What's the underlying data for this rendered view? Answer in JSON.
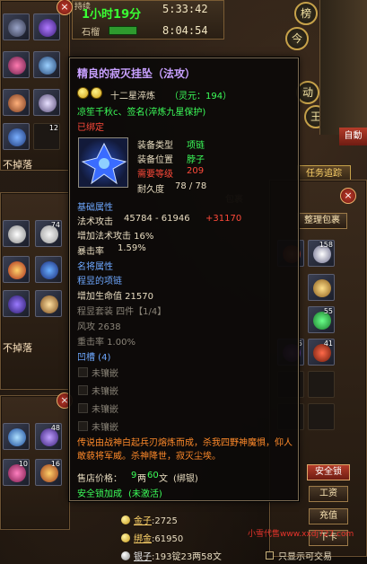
{
  "header": {
    "timer_green": "1小时19分",
    "top_small_left": "持续",
    "time_1": "5:33:42",
    "timer_label_2": "石榴",
    "time_2": "8:04:54"
  },
  "side_buttons": [
    "榜",
    "今",
    "动",
    "王"
  ],
  "right_top_label": "自動",
  "quest_tab": "任务追踪",
  "bag_title": "包裹",
  "bag_sort_button": "整理包裹",
  "no_drop_label_1": "不掉落",
  "no_drop_label_2": "不掉落",
  "left_slot_numbers": [
    "12",
    "74",
    "48",
    "10",
    "16"
  ],
  "bag_slot_numbers": [
    "158",
    "55",
    "41",
    "5"
  ],
  "tooltip": {
    "title": "精良的寂灭挂坠（法攻）",
    "refine": "十二星淬炼",
    "spirit": "（灵元：194）",
    "signature": "凉笙千秋c、签名(淬炼九星保护)",
    "bound": "已绑定",
    "item_type_label": "装备类型",
    "item_type_value": "项链",
    "item_slot_label": "装备位置",
    "item_slot_value": "脖子",
    "level_req_label": "需要等级",
    "level_req_value": "209",
    "durability_label": "耐久度",
    "durability_value": "78 / 78",
    "base_attr_header": "基础属性",
    "magic_atk_label": "法术攻击",
    "magic_atk_value": "45784 - 61946",
    "magic_atk_bonus": "+31170",
    "inc_magic_atk": "增加法术攻击 16%",
    "crit_label": "暴击率",
    "crit_value": "1.59%",
    "famous_header": "名将属性",
    "set_header": "程昱的项链",
    "add_hp": "增加生命值 21570",
    "set_label": "程昱套装 四件【1/4】",
    "wind_atk": "风攻 2638",
    "heavy_hit": "重击率 1.00%",
    "socket_header": "凹槽 (4)",
    "sockets": [
      "未镶嵌",
      "未镶嵌",
      "未镶嵌",
      "未镶嵌"
    ],
    "lore": "传说由战神白起兵刃熔炼而成，杀我四野神魔惧，仰人敢藐将军威。杀神降世，寂灭尘埃。",
    "price_label": "售店价格：",
    "price_value_a": "9",
    "price_unit_a": "两",
    "price_value_b": "60",
    "price_unit_b": "文",
    "price_bound": "(绑银)",
    "safe_lock": "安全锁加成",
    "safe_lock_status": "(未激活)"
  },
  "right_buttons": {
    "safe_lock": "安全锁",
    "salary": "工资",
    "recharge": "充值",
    "next_page": "下卡"
  },
  "money": {
    "gold_label": "金子",
    "gold_value": ":2725",
    "bound_gold_label": "绑金",
    "bound_gold_value": ":61950",
    "silver_label": "银子",
    "silver_value": ":193锭23两58文"
  },
  "tradable_only": "只显示可交易",
  "watermark": "小雪代售www.xxdj727.com",
  "colors": {
    "title_purple": "#c8a0ff",
    "attr_green": "#3cff5a",
    "famous_blue": "#6ea8ff",
    "bound_red": "#ff4a3a",
    "lore_orange": "#ff8a2a",
    "gold_yellow": "#ffd46a"
  }
}
